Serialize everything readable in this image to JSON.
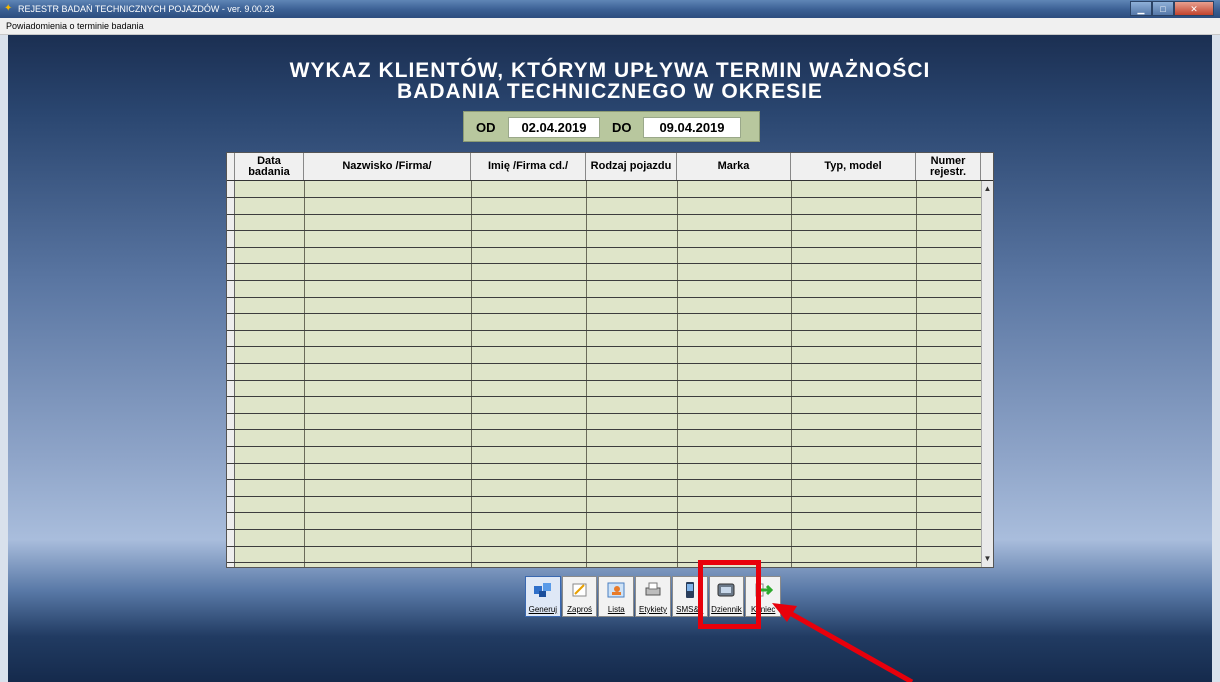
{
  "window": {
    "title": "REJESTR BADAŃ TECHNICZNYCH POJAZDÓW -  ver. 9.00.23",
    "controls": [
      "minimize",
      "maximize",
      "close"
    ]
  },
  "menu": {
    "label": "Powiadomienia o terminie badania"
  },
  "heading": {
    "line1": "WYKAZ KLIENTÓW, KTÓRYM UPŁYWA TERMIN WAŻNOŚCI",
    "line2": "BADANIA TECHNICZNEGO W OKRESIE"
  },
  "date_range": {
    "from_label": "OD",
    "from_value": "02.04.2019",
    "to_label": "DO",
    "to_value": "09.04.2019"
  },
  "table": {
    "columns": [
      "Data badania",
      "Nazwisko /Firma/",
      "Imię /Firma cd./",
      "Rodzaj pojazdu",
      "Marka",
      "Typ, model",
      "Numer rejestr."
    ],
    "rows": []
  },
  "toolbar": {
    "buttons": [
      {
        "label": "Generuj",
        "icon": "generate-icon"
      },
      {
        "label": "Zaproś",
        "icon": "invite-icon"
      },
      {
        "label": "Lista",
        "icon": "list-icon"
      },
      {
        "label": "Etykiety",
        "icon": "printer-icon"
      },
      {
        "label": "SMS&e",
        "icon": "phone-icon"
      },
      {
        "label": "Dziennik",
        "icon": "journal-icon"
      },
      {
        "label": "Koniec",
        "icon": "exit-icon"
      }
    ]
  },
  "colors": {
    "grid_background": "#dfe5c9",
    "date_panel": "#b8c79e",
    "highlight": "#e8000b"
  }
}
